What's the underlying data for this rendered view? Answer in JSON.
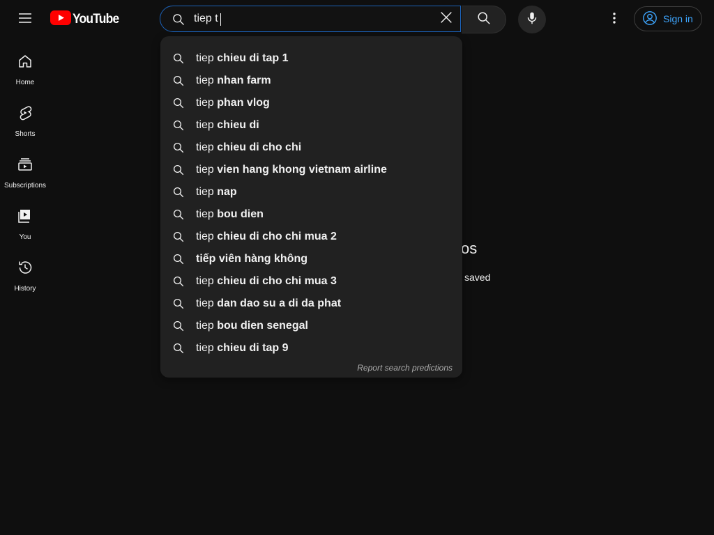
{
  "header": {
    "logo_text": "YouTube",
    "search": {
      "value": "tiep t"
    },
    "signin_label": "Sign in"
  },
  "nav": {
    "items": [
      {
        "label": "Home",
        "icon": "home-icon"
      },
      {
        "label": "Shorts",
        "icon": "shorts-icon"
      },
      {
        "label": "Subscriptions",
        "icon": "subscriptions-icon"
      },
      {
        "label": "You",
        "icon": "you-icon"
      },
      {
        "label": "History",
        "icon": "history-icon"
      }
    ]
  },
  "background": {
    "title_fragment": "os",
    "subtitle_fragment": "saved"
  },
  "suggestions": {
    "items": [
      {
        "prefix": "tiep ",
        "bold": "chieu di tap 1"
      },
      {
        "prefix": "tiep ",
        "bold": "nhan farm"
      },
      {
        "prefix": "tiep ",
        "bold": "phan vlog"
      },
      {
        "prefix": "tiep ",
        "bold": "chieu di"
      },
      {
        "prefix": "tiep ",
        "bold": "chieu di cho chi"
      },
      {
        "prefix": "tiep ",
        "bold": "vien hang khong vietnam airline"
      },
      {
        "prefix": "tiep ",
        "bold": "nap"
      },
      {
        "prefix": "tiep ",
        "bold": "bou dien"
      },
      {
        "prefix": "tiep ",
        "bold": "chieu di cho chi mua 2"
      },
      {
        "prefix": "",
        "bold": "tiếp viên hàng không"
      },
      {
        "prefix": "tiep ",
        "bold": "chieu di cho chi mua 3"
      },
      {
        "prefix": "tiep ",
        "bold": "dan dao su a di da phat"
      },
      {
        "prefix": "tiep ",
        "bold": "bou dien senegal"
      },
      {
        "prefix": "tiep ",
        "bold": "chieu di tap 9"
      }
    ],
    "report_label": "Report search predictions"
  },
  "colors": {
    "background": "#0f0f0f",
    "dropdown": "#212121",
    "accent_blue": "#3ea6ff",
    "brand_red": "#ff0000"
  }
}
